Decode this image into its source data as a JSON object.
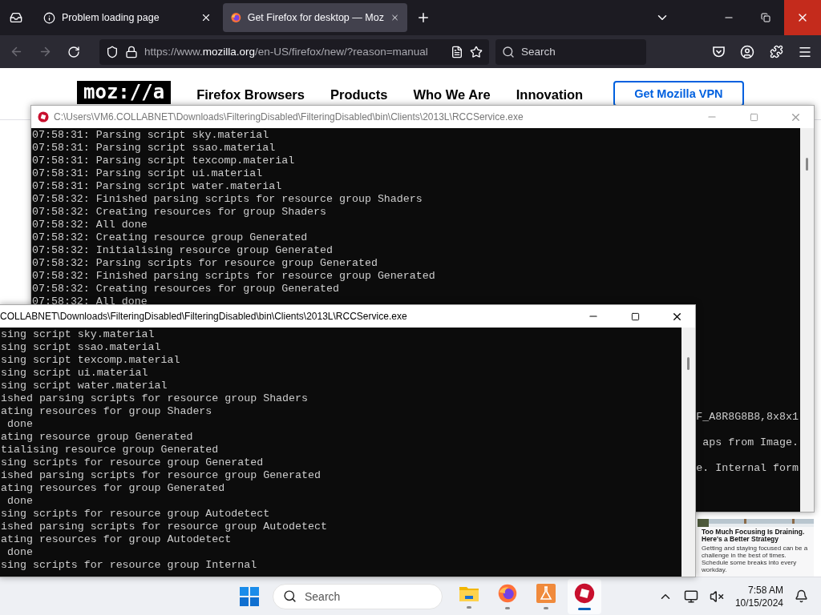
{
  "browser": {
    "tabs": [
      {
        "title": "Problem loading page",
        "selected": false,
        "kind": "info"
      },
      {
        "title": "Get Firefox for desktop — Moz",
        "selected": true,
        "kind": "firefox"
      }
    ],
    "close_hovered": true,
    "url": {
      "scheme": "https://www.",
      "domain": "mozilla.org",
      "path": "/en-US/firefox/new/?reason=manual"
    },
    "search": {
      "placeholder": "Search"
    }
  },
  "page": {
    "logo": "moz://a",
    "nav": [
      "Firefox Browsers",
      "Products",
      "Who We Are",
      "Innovation"
    ],
    "cta": "Get Mozilla VPN",
    "news_card": {
      "title": "Too Much Focusing Is Draining. Here's a Better Strategy",
      "description": "Getting and staying focused can be a challenge in the best of times. Schedule some breaks into every workday."
    }
  },
  "consoles": [
    {
      "title": "C:\\Users\\VM6.COLLABNET\\Downloads\\FilteringDisabled\\FilteringDisabled\\bin\\Clients\\2013L\\RCCService.exe",
      "active": false,
      "icon_visible": true,
      "lines": [
        "07:58:31: Parsing script sky.material",
        "07:58:31: Parsing script ssao.material",
        "07:58:31: Parsing script texcomp.material",
        "07:58:31: Parsing script ui.material",
        "07:58:31: Parsing script water.material",
        "07:58:32: Finished parsing scripts for resource group Shaders",
        "07:58:32: Creating resources for group Shaders",
        "07:58:32: All done",
        "07:58:32: Creating resource group Generated",
        "07:58:32: Initialising resource group Generated",
        "07:58:32: Parsing scripts for resource group Generated",
        "07:58:32: Finished parsing scripts for resource group Generated",
        "07:58:32: Creating resources for group Generated",
        "07:58:32: All done"
      ],
      "fragments": [
        "F_A8R8G8B8,8x8x1",
        "aps from Image.",
        "e. Internal form"
      ]
    },
    {
      "title": "COLLABNET\\Downloads\\FilteringDisabled\\FilteringDisabled\\bin\\Clients\\2013L\\RCCService.exe",
      "active": true,
      "icon_visible": false,
      "lines": [
        "sing script sky.material",
        "sing script ssao.material",
        "sing script texcomp.material",
        "sing script ui.material",
        "sing script water.material",
        "ished parsing scripts for resource group Shaders",
        "ating resources for group Shaders",
        " done",
        "ating resource group Generated",
        "tialising resource group Generated",
        "sing scripts for resource group Generated",
        "ished parsing scripts for resource group Generated",
        "ating resources for group Generated",
        " done",
        "sing scripts for resource group Autodetect",
        "ished parsing scripts for resource group Autodetect",
        "ating resources for group Autodetect",
        " done",
        "sing scripts for resource group Internal"
      ]
    }
  ],
  "taskbar": {
    "search": {
      "placeholder": "Search"
    },
    "apps": [
      {
        "kind": "folder",
        "selected": false
      },
      {
        "kind": "firefox",
        "selected": false
      },
      {
        "kind": "flask",
        "selected": false
      },
      {
        "kind": "roblox",
        "selected": true
      }
    ],
    "time": "7:58 AM",
    "date": "10/15/2024"
  }
}
